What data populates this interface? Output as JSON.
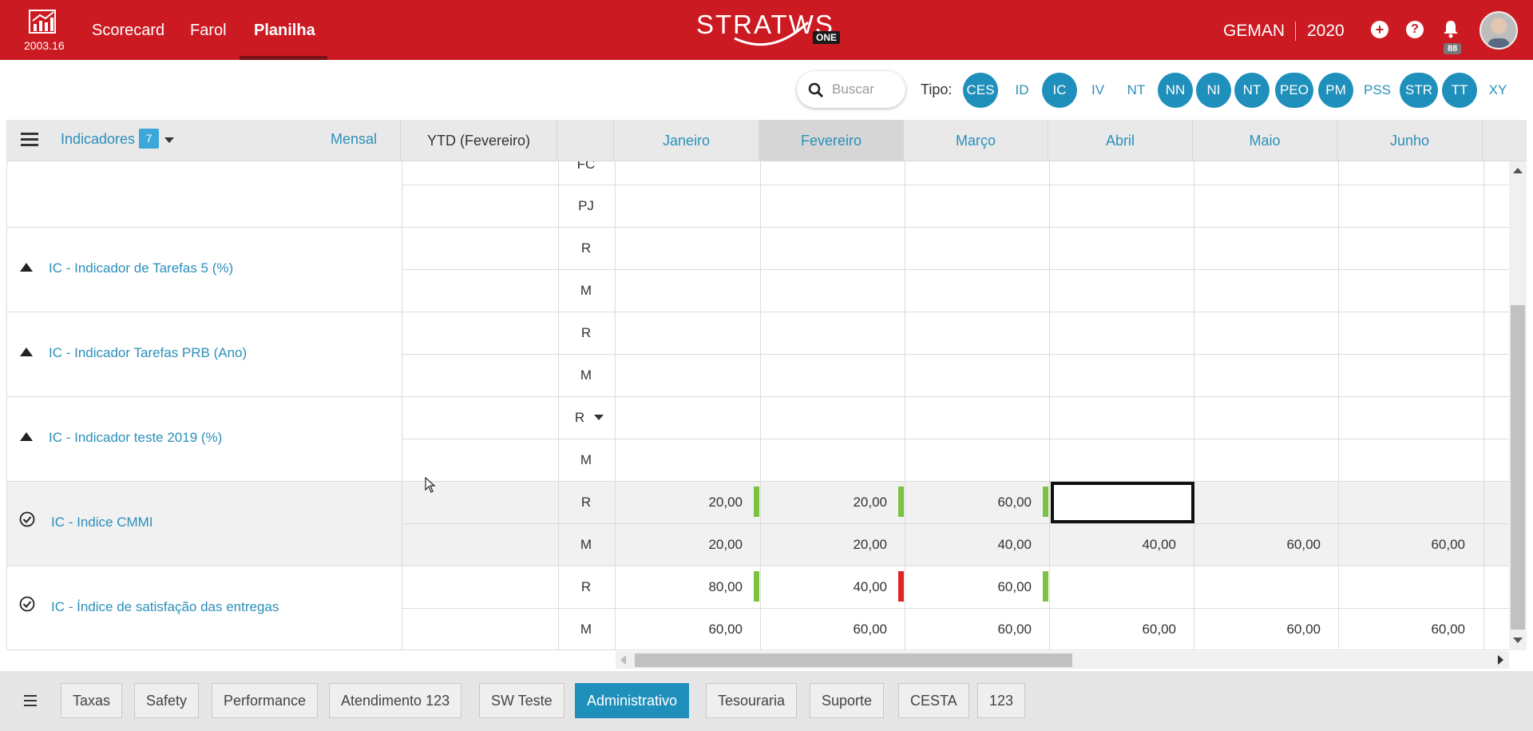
{
  "header": {
    "version": "2003.16",
    "nav": [
      "Scorecard",
      "Farol",
      "Planilha"
    ],
    "brand": "STRATWS",
    "brand_suffix": "ONE",
    "org": "GEMAN",
    "year": "2020",
    "notifications": "88",
    "icons": [
      "chart-logo-icon",
      "plus-icon",
      "help-icon",
      "bell-icon",
      "user-avatar"
    ]
  },
  "filter": {
    "search_placeholder": "Buscar",
    "tipo_label": "Tipo:",
    "tipos": [
      {
        "label": "CES",
        "active": true
      },
      {
        "label": "ID",
        "active": false
      },
      {
        "label": "IC",
        "active": true
      },
      {
        "label": "IV",
        "active": false
      },
      {
        "label": "NT",
        "active": false
      },
      {
        "label": "NN",
        "active": true
      },
      {
        "label": "NI",
        "active": true
      },
      {
        "label": "NT",
        "active": true
      },
      {
        "label": "PEO",
        "active": true
      },
      {
        "label": "PM",
        "active": true
      },
      {
        "label": "PSS",
        "active": false
      },
      {
        "label": "STR",
        "active": true
      },
      {
        "label": "TT",
        "active": true
      },
      {
        "label": "XY",
        "active": false
      }
    ]
  },
  "grid": {
    "indicadores_label": "Indicadores",
    "indicadores_count": "7",
    "period": "Mensal",
    "ytd": "YTD (Fevereiro)",
    "months": [
      "Janeiro",
      "Fevereiro",
      "Março",
      "Abril",
      "Maio",
      "Junho"
    ],
    "selected_month": "Fevereiro",
    "partial_rows": [
      "FC",
      "PJ"
    ],
    "indicators": [
      {
        "name": "IC - Indicador de Tarefas 5 (%)",
        "icon": "triangle-up-icon",
        "rows": [
          {
            "type": "R",
            "values": [
              "",
              "",
              "",
              "",
              "",
              ""
            ]
          },
          {
            "type": "M",
            "values": [
              "",
              "",
              "",
              "",
              "",
              ""
            ]
          }
        ]
      },
      {
        "name": "IC - Indicador Tarefas PRB (Ano)",
        "icon": "triangle-up-icon",
        "rows": [
          {
            "type": "R",
            "values": [
              "",
              "",
              "",
              "",
              "",
              ""
            ]
          },
          {
            "type": "M",
            "values": [
              "",
              "",
              "",
              "",
              "",
              ""
            ]
          }
        ]
      },
      {
        "name": "IC - Indicador teste 2019 (%)",
        "icon": "triangle-up-icon",
        "rows": [
          {
            "type": "R",
            "values": [
              "",
              "",
              "",
              "",
              "",
              ""
            ]
          },
          {
            "type": "M",
            "values": [
              "",
              "",
              "",
              "",
              "",
              ""
            ]
          }
        ]
      },
      {
        "name": "IC - Indice CMMI",
        "icon": "check-circle-icon",
        "rows": [
          {
            "type": "R",
            "values": [
              "20,00",
              "20,00",
              "60,00",
              "",
              "",
              ""
            ],
            "flags": [
              "green",
              "green",
              "green",
              "",
              "",
              ""
            ]
          },
          {
            "type": "M",
            "values": [
              "20,00",
              "20,00",
              "40,00",
              "40,00",
              "60,00",
              "60,00"
            ]
          }
        ]
      },
      {
        "name": "IC - Índice de satisfação das entregas",
        "icon": "check-circle-icon",
        "rows": [
          {
            "type": "R",
            "values": [
              "80,00",
              "40,00",
              "60,00",
              "",
              "",
              ""
            ],
            "flags": [
              "green",
              "red",
              "green",
              "",
              "",
              ""
            ]
          },
          {
            "type": "M",
            "values": [
              "60,00",
              "60,00",
              "60,00",
              "60,00",
              "60,00",
              "60,00"
            ]
          }
        ]
      }
    ]
  },
  "footer": {
    "tabs": [
      "Taxas",
      "Safety",
      "Performance",
      "Atendimento 123",
      "SW Teste",
      "Administrativo",
      "Tesouraria",
      "Suporte",
      "CESTA",
      "123"
    ],
    "active_tab": "Administrativo"
  },
  "colors": {
    "header_red": "#cc1a22",
    "accent_blue": "#2b8fba",
    "flag_green": "#7cc242",
    "flag_red": "#e02424"
  }
}
